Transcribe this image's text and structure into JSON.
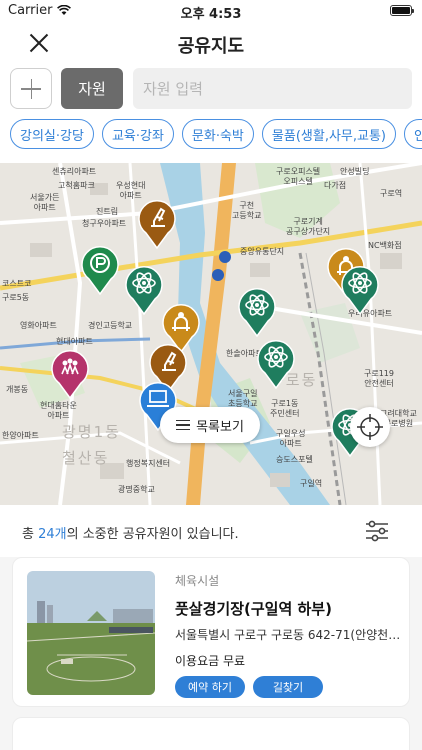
{
  "status": {
    "carrier": "Carrier",
    "time": "오후 4:53",
    "battery_level": 1.0
  },
  "header": {
    "title": "공유지도"
  },
  "search": {
    "category_label": "자원",
    "placeholder": "자원 입력",
    "value": ""
  },
  "chips": [
    "강의실·강당",
    "교육·강좌",
    "문화·숙박",
    "물품(생활,사무,교통)",
    "인"
  ],
  "map": {
    "labels": {
      "sinsegye_apt": "센츄리아파트",
      "gocheok_baeksi": "고척홈파크",
      "seoulgaryeom_apt": "서울가든\n아파트",
      "jintong": "진트림",
      "cheongguyu_apt": "청구우아파트",
      "wooseong_apt": "우성현대\n아파트",
      "guro_church_school": "구천\n고등학교",
      "guro_office": "구로오피스텔\n오피스텔",
      "daga": "다가점",
      "anseong": "안성빌딩",
      "guro_station": "구로역",
      "nc_dept": "NC백화점",
      "guro_gongguchang": "구로기계\n공구상가단지",
      "jungang_tower": "중앙유통단지",
      "konkuk_apt": "코스트코",
      "guro_5dong": "구로5동",
      "gaebong_apt": "영화아파트",
      "gyeongin_school": "경인고등학교",
      "hyundai_apt": "현대아파트",
      "uriyuma": "우리유아파트",
      "guro119": "구로119\n안전센터",
      "hansol_apt": "한솔아파트",
      "gaebongdong": "개봉동",
      "seoulgaryeom2": "서울구일\n초등학교",
      "guro_1dong_center": "구로1동\n주민센터",
      "hyundai_high": "현대홈타운\n아파트",
      "guil_apt": "구일우성\n아파트",
      "hanyang_apt": "한양아파트",
      "guro_high": "고려대학교\n구로병원",
      "gaebong1": "광명1동",
      "cheolsan": "철산동",
      "haengjeong_center": "행정복지센터",
      "gwangmyeong_middle": "광명중학교",
      "seungdo": "승도스포텔",
      "guil_station": "구일역",
      "district_guro": "구로동"
    },
    "list_view_label": "목록보기"
  },
  "summary": {
    "prefix": "총 ",
    "count": "24개",
    "suffix": "의 소중한 공유자원이 있습니다."
  },
  "cards": [
    {
      "category": "체육시설",
      "title": "풋살경기장(구일역 하부)",
      "address": "서울특별시 구로구 구로동 642-71(안양천변…",
      "fee": "이용요금 무료",
      "reserve_label": "예약 하기",
      "route_label": "길찾기"
    }
  ],
  "colors": {
    "accent": "#2f7fd6",
    "pin_green": "#1f8a4c",
    "pin_brown": "#9a5a12",
    "pin_orange": "#c98a1a",
    "pin_magenta": "#b5336b",
    "pin_blue": "#2a7fd8",
    "teal": "#1f7d5e"
  },
  "icons": [
    "wifi-icon",
    "battery-icon",
    "close-icon",
    "plus-icon",
    "list-icon",
    "crosshair-icon",
    "filter-icon",
    "microscope-icon",
    "atom-icon",
    "people-icon",
    "coin-icon",
    "laptop-icon"
  ]
}
